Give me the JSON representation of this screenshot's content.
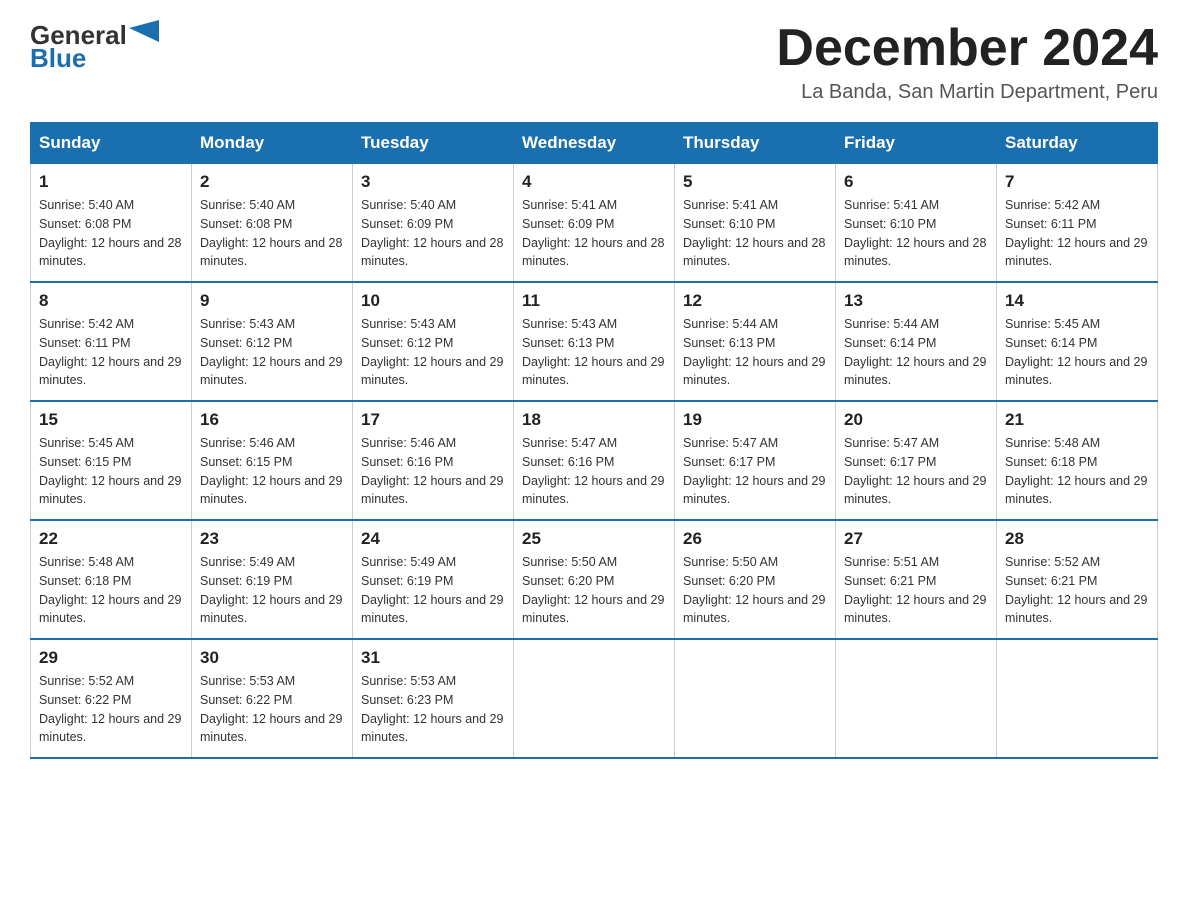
{
  "header": {
    "logo_general": "General",
    "logo_blue": "Blue",
    "month_title": "December 2024",
    "location": "La Banda, San Martin Department, Peru"
  },
  "days_of_week": [
    "Sunday",
    "Monday",
    "Tuesday",
    "Wednesday",
    "Thursday",
    "Friday",
    "Saturday"
  ],
  "weeks": [
    [
      {
        "day": "1",
        "sunrise": "5:40 AM",
        "sunset": "6:08 PM",
        "daylight": "12 hours and 28 minutes."
      },
      {
        "day": "2",
        "sunrise": "5:40 AM",
        "sunset": "6:08 PM",
        "daylight": "12 hours and 28 minutes."
      },
      {
        "day": "3",
        "sunrise": "5:40 AM",
        "sunset": "6:09 PM",
        "daylight": "12 hours and 28 minutes."
      },
      {
        "day": "4",
        "sunrise": "5:41 AM",
        "sunset": "6:09 PM",
        "daylight": "12 hours and 28 minutes."
      },
      {
        "day": "5",
        "sunrise": "5:41 AM",
        "sunset": "6:10 PM",
        "daylight": "12 hours and 28 minutes."
      },
      {
        "day": "6",
        "sunrise": "5:41 AM",
        "sunset": "6:10 PM",
        "daylight": "12 hours and 28 minutes."
      },
      {
        "day": "7",
        "sunrise": "5:42 AM",
        "sunset": "6:11 PM",
        "daylight": "12 hours and 29 minutes."
      }
    ],
    [
      {
        "day": "8",
        "sunrise": "5:42 AM",
        "sunset": "6:11 PM",
        "daylight": "12 hours and 29 minutes."
      },
      {
        "day": "9",
        "sunrise": "5:43 AM",
        "sunset": "6:12 PM",
        "daylight": "12 hours and 29 minutes."
      },
      {
        "day": "10",
        "sunrise": "5:43 AM",
        "sunset": "6:12 PM",
        "daylight": "12 hours and 29 minutes."
      },
      {
        "day": "11",
        "sunrise": "5:43 AM",
        "sunset": "6:13 PM",
        "daylight": "12 hours and 29 minutes."
      },
      {
        "day": "12",
        "sunrise": "5:44 AM",
        "sunset": "6:13 PM",
        "daylight": "12 hours and 29 minutes."
      },
      {
        "day": "13",
        "sunrise": "5:44 AM",
        "sunset": "6:14 PM",
        "daylight": "12 hours and 29 minutes."
      },
      {
        "day": "14",
        "sunrise": "5:45 AM",
        "sunset": "6:14 PM",
        "daylight": "12 hours and 29 minutes."
      }
    ],
    [
      {
        "day": "15",
        "sunrise": "5:45 AM",
        "sunset": "6:15 PM",
        "daylight": "12 hours and 29 minutes."
      },
      {
        "day": "16",
        "sunrise": "5:46 AM",
        "sunset": "6:15 PM",
        "daylight": "12 hours and 29 minutes."
      },
      {
        "day": "17",
        "sunrise": "5:46 AM",
        "sunset": "6:16 PM",
        "daylight": "12 hours and 29 minutes."
      },
      {
        "day": "18",
        "sunrise": "5:47 AM",
        "sunset": "6:16 PM",
        "daylight": "12 hours and 29 minutes."
      },
      {
        "day": "19",
        "sunrise": "5:47 AM",
        "sunset": "6:17 PM",
        "daylight": "12 hours and 29 minutes."
      },
      {
        "day": "20",
        "sunrise": "5:47 AM",
        "sunset": "6:17 PM",
        "daylight": "12 hours and 29 minutes."
      },
      {
        "day": "21",
        "sunrise": "5:48 AM",
        "sunset": "6:18 PM",
        "daylight": "12 hours and 29 minutes."
      }
    ],
    [
      {
        "day": "22",
        "sunrise": "5:48 AM",
        "sunset": "6:18 PM",
        "daylight": "12 hours and 29 minutes."
      },
      {
        "day": "23",
        "sunrise": "5:49 AM",
        "sunset": "6:19 PM",
        "daylight": "12 hours and 29 minutes."
      },
      {
        "day": "24",
        "sunrise": "5:49 AM",
        "sunset": "6:19 PM",
        "daylight": "12 hours and 29 minutes."
      },
      {
        "day": "25",
        "sunrise": "5:50 AM",
        "sunset": "6:20 PM",
        "daylight": "12 hours and 29 minutes."
      },
      {
        "day": "26",
        "sunrise": "5:50 AM",
        "sunset": "6:20 PM",
        "daylight": "12 hours and 29 minutes."
      },
      {
        "day": "27",
        "sunrise": "5:51 AM",
        "sunset": "6:21 PM",
        "daylight": "12 hours and 29 minutes."
      },
      {
        "day": "28",
        "sunrise": "5:52 AM",
        "sunset": "6:21 PM",
        "daylight": "12 hours and 29 minutes."
      }
    ],
    [
      {
        "day": "29",
        "sunrise": "5:52 AM",
        "sunset": "6:22 PM",
        "daylight": "12 hours and 29 minutes."
      },
      {
        "day": "30",
        "sunrise": "5:53 AM",
        "sunset": "6:22 PM",
        "daylight": "12 hours and 29 minutes."
      },
      {
        "day": "31",
        "sunrise": "5:53 AM",
        "sunset": "6:23 PM",
        "daylight": "12 hours and 29 minutes."
      },
      {
        "day": "",
        "sunrise": "",
        "sunset": "",
        "daylight": ""
      },
      {
        "day": "",
        "sunrise": "",
        "sunset": "",
        "daylight": ""
      },
      {
        "day": "",
        "sunrise": "",
        "sunset": "",
        "daylight": ""
      },
      {
        "day": "",
        "sunrise": "",
        "sunset": "",
        "daylight": ""
      }
    ]
  ],
  "labels": {
    "sunrise_prefix": "Sunrise: ",
    "sunset_prefix": "Sunset: ",
    "daylight_prefix": "Daylight: "
  }
}
